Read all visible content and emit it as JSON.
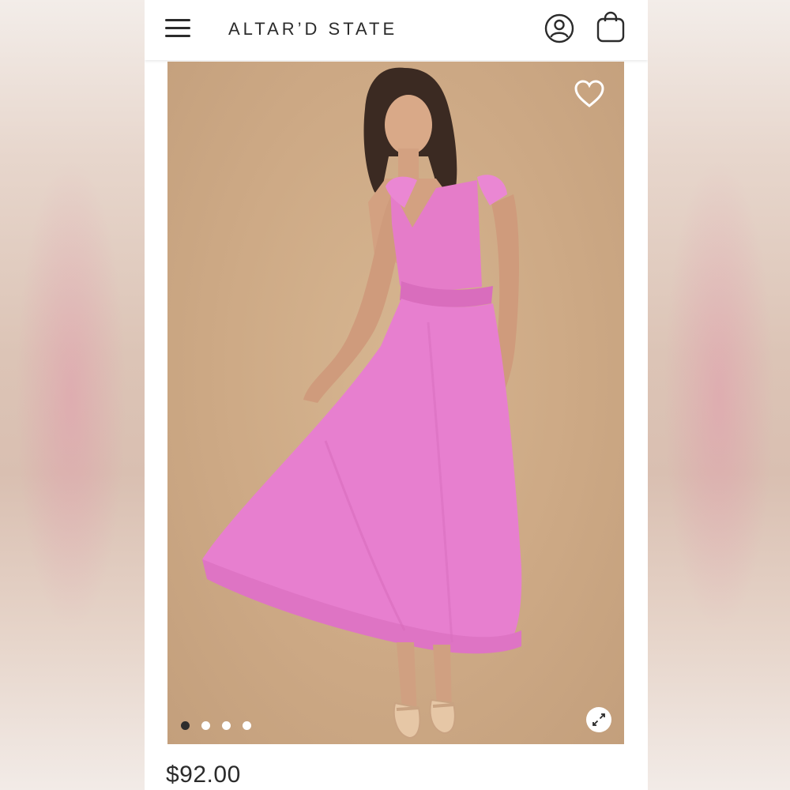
{
  "header": {
    "brand": "ALTAR’D STATE",
    "icons": [
      "menu-icon",
      "account-icon",
      "shopping-bag-icon"
    ]
  },
  "product": {
    "image_icons": [
      "heart-icon",
      "expand-icon"
    ],
    "carousel": {
      "total_slides": 4,
      "active_slide": 1
    },
    "dress_color": "#e77fcf",
    "background_color": "#cfab87",
    "price": "$92.00"
  }
}
